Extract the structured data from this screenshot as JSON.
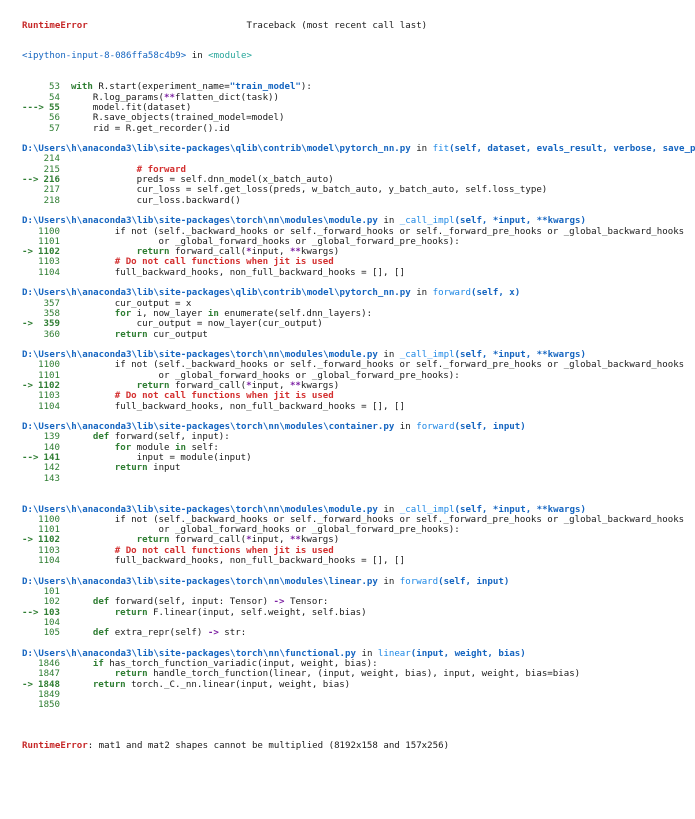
{
  "header": {
    "error_name": "RuntimeError",
    "traceback_label": "Traceback (most recent call last)",
    "input_cell": "<ipython-input-8-086ffa58c4b9>",
    "in_word": "in",
    "module_label": "<module>"
  },
  "frames": [
    {
      "lines": [
        {
          "n": "53",
          "arrow": "",
          "segs": [
            {
              "t": "with",
              "c": "kw"
            },
            {
              "t": " R.start(experiment_name=",
              "c": ""
            },
            {
              "t": "\"train_model\"",
              "c": "str"
            },
            {
              "t": "):",
              "c": ""
            }
          ]
        },
        {
          "n": "54",
          "arrow": "",
          "segs": [
            {
              "t": "    R.log_params(",
              "c": ""
            },
            {
              "t": "**",
              "c": "op"
            },
            {
              "t": "flatten_dict(task))",
              "c": ""
            }
          ]
        },
        {
          "n": "55",
          "arrow": "--->",
          "segs": [
            {
              "t": "    model.fit(dataset)",
              "c": ""
            }
          ]
        },
        {
          "n": "56",
          "arrow": "",
          "segs": [
            {
              "t": "    R.save_objects(trained_model=model)",
              "c": ""
            }
          ]
        },
        {
          "n": "57",
          "arrow": "",
          "segs": [
            {
              "t": "    rid = R.get_recorder().id",
              "c": ""
            }
          ]
        }
      ]
    },
    {
      "path": "D:\\Users\\h\\anaconda3\\lib\\site-packages\\qlib\\contrib\\model\\pytorch_nn.py",
      "func": "fit",
      "sig": "(self, dataset, evals_result, verbose, save_pa",
      "lines": [
        {
          "n": "214",
          "arrow": "",
          "segs": []
        },
        {
          "n": "215",
          "arrow": "",
          "segs": [
            {
              "t": "            # forward",
              "c": "cm"
            }
          ]
        },
        {
          "n": "216",
          "arrow": "-->",
          "segs": [
            {
              "t": "            preds = self.dnn_model(x_batch_auto)",
              "c": ""
            }
          ]
        },
        {
          "n": "217",
          "arrow": "",
          "segs": [
            {
              "t": "            cur_loss = self.get_loss(preds, w_batch_auto, y_batch_auto, self.loss_type)",
              "c": ""
            }
          ]
        },
        {
          "n": "218",
          "arrow": "",
          "segs": [
            {
              "t": "            cur_loss.backward()",
              "c": ""
            }
          ]
        }
      ]
    },
    {
      "path": "D:\\Users\\h\\anaconda3\\lib\\site-packages\\torch\\nn\\modules\\module.py",
      "func": "_call_impl",
      "sig": "(self, *input, **kwargs)",
      "lines": [
        {
          "n": "1100",
          "arrow": "",
          "segs": [
            {
              "t": "        if not (self._backward_hooks or self._forward_hooks or self._forward_pre_hooks or _global_backward_hooks",
              "c": ""
            }
          ]
        },
        {
          "n": "1101",
          "arrow": "",
          "segs": [
            {
              "t": "                or _global_forward_hooks or _global_forward_pre_hooks):",
              "c": ""
            }
          ]
        },
        {
          "n": "1102",
          "arrow": "->",
          "segs": [
            {
              "t": "            ",
              "c": ""
            },
            {
              "t": "return",
              "c": "kw"
            },
            {
              "t": " forward_call(",
              "c": ""
            },
            {
              "t": "*",
              "c": "op"
            },
            {
              "t": "input, ",
              "c": ""
            },
            {
              "t": "**",
              "c": "op"
            },
            {
              "t": "kwargs)",
              "c": ""
            }
          ]
        },
        {
          "n": "1103",
          "arrow": "",
          "segs": [
            {
              "t": "        # Do not call functions when jit is used",
              "c": "cm"
            }
          ]
        },
        {
          "n": "1104",
          "arrow": "",
          "segs": [
            {
              "t": "        full_backward_hooks, non_full_backward_hooks = [], []",
              "c": ""
            }
          ]
        }
      ]
    },
    {
      "path": "D:\\Users\\h\\anaconda3\\lib\\site-packages\\qlib\\contrib\\model\\pytorch_nn.py",
      "func": "forward",
      "sig": "(self, x)",
      "lines": [
        {
          "n": "357",
          "arrow": "",
          "segs": [
            {
              "t": "        cur_output = x",
              "c": ""
            }
          ]
        },
        {
          "n": "358",
          "arrow": "",
          "segs": [
            {
              "t": "        ",
              "c": ""
            },
            {
              "t": "for",
              "c": "kw"
            },
            {
              "t": " i, now_layer ",
              "c": ""
            },
            {
              "t": "in",
              "c": "kw"
            },
            {
              "t": " enumerate(self.dnn_layers):",
              "c": ""
            }
          ]
        },
        {
          "n": "359",
          "arrow": "->",
          "segs": [
            {
              "t": "            cur_output = now_layer(cur_output)",
              "c": ""
            }
          ]
        },
        {
          "n": "360",
          "arrow": "",
          "segs": [
            {
              "t": "        ",
              "c": ""
            },
            {
              "t": "return",
              "c": "kw"
            },
            {
              "t": " cur_output",
              "c": ""
            }
          ]
        }
      ]
    },
    {
      "path": "D:\\Users\\h\\anaconda3\\lib\\site-packages\\torch\\nn\\modules\\module.py",
      "func": "_call_impl",
      "sig": "(self, *input, **kwargs)",
      "lines": [
        {
          "n": "1100",
          "arrow": "",
          "segs": [
            {
              "t": "        if not (self._backward_hooks or self._forward_hooks or self._forward_pre_hooks or _global_backward_hooks",
              "c": ""
            }
          ]
        },
        {
          "n": "1101",
          "arrow": "",
          "segs": [
            {
              "t": "                or _global_forward_hooks or _global_forward_pre_hooks):",
              "c": ""
            }
          ]
        },
        {
          "n": "1102",
          "arrow": "->",
          "segs": [
            {
              "t": "            ",
              "c": ""
            },
            {
              "t": "return",
              "c": "kw"
            },
            {
              "t": " forward_call(",
              "c": ""
            },
            {
              "t": "*",
              "c": "op"
            },
            {
              "t": "input, ",
              "c": ""
            },
            {
              "t": "**",
              "c": "op"
            },
            {
              "t": "kwargs)",
              "c": ""
            }
          ]
        },
        {
          "n": "1103",
          "arrow": "",
          "segs": [
            {
              "t": "        # Do not call functions when jit is used",
              "c": "cm"
            }
          ]
        },
        {
          "n": "1104",
          "arrow": "",
          "segs": [
            {
              "t": "        full_backward_hooks, non_full_backward_hooks = [], []",
              "c": ""
            }
          ]
        }
      ]
    },
    {
      "path": "D:\\Users\\h\\anaconda3\\lib\\site-packages\\torch\\nn\\modules\\container.py",
      "func": "forward",
      "sig": "(self, input)",
      "trail": 1,
      "lines": [
        {
          "n": "139",
          "arrow": "",
          "segs": [
            {
              "t": "    ",
              "c": ""
            },
            {
              "t": "def",
              "c": "kw"
            },
            {
              "t": " forward(self, input):",
              "c": ""
            }
          ]
        },
        {
          "n": "140",
          "arrow": "",
          "segs": [
            {
              "t": "        ",
              "c": ""
            },
            {
              "t": "for",
              "c": "kw"
            },
            {
              "t": " module ",
              "c": ""
            },
            {
              "t": "in",
              "c": "kw"
            },
            {
              "t": " self:",
              "c": ""
            }
          ]
        },
        {
          "n": "141",
          "arrow": "-->",
          "segs": [
            {
              "t": "            input = module(input)",
              "c": ""
            }
          ]
        },
        {
          "n": "142",
          "arrow": "",
          "segs": [
            {
              "t": "        ",
              "c": ""
            },
            {
              "t": "return",
              "c": "kw"
            },
            {
              "t": " input",
              "c": ""
            }
          ]
        },
        {
          "n": "143",
          "arrow": "",
          "segs": []
        }
      ]
    },
    {
      "path": "D:\\Users\\h\\anaconda3\\lib\\site-packages\\torch\\nn\\modules\\module.py",
      "func": "_call_impl",
      "sig": "(self, *input, **kwargs)",
      "lines": [
        {
          "n": "1100",
          "arrow": "",
          "segs": [
            {
              "t": "        if not (self._backward_hooks or self._forward_hooks or self._forward_pre_hooks or _global_backward_hooks",
              "c": ""
            }
          ]
        },
        {
          "n": "1101",
          "arrow": "",
          "segs": [
            {
              "t": "                or _global_forward_hooks or _global_forward_pre_hooks):",
              "c": ""
            }
          ]
        },
        {
          "n": "1102",
          "arrow": "->",
          "segs": [
            {
              "t": "            ",
              "c": ""
            },
            {
              "t": "return",
              "c": "kw"
            },
            {
              "t": " forward_call(",
              "c": ""
            },
            {
              "t": "*",
              "c": "op"
            },
            {
              "t": "input, ",
              "c": ""
            },
            {
              "t": "**",
              "c": "op"
            },
            {
              "t": "kwargs)",
              "c": ""
            }
          ]
        },
        {
          "n": "1103",
          "arrow": "",
          "segs": [
            {
              "t": "        # Do not call functions when jit is used",
              "c": "cm"
            }
          ]
        },
        {
          "n": "1104",
          "arrow": "",
          "segs": [
            {
              "t": "        full_backward_hooks, non_full_backward_hooks = [], []",
              "c": ""
            }
          ]
        }
      ]
    },
    {
      "path": "D:\\Users\\h\\anaconda3\\lib\\site-packages\\torch\\nn\\modules\\linear.py",
      "func": "forward",
      "sig": "(self, input)",
      "lines": [
        {
          "n": "101",
          "arrow": "",
          "segs": []
        },
        {
          "n": "102",
          "arrow": "",
          "segs": [
            {
              "t": "    ",
              "c": ""
            },
            {
              "t": "def",
              "c": "kw"
            },
            {
              "t": " forward(self, input: Tensor) ",
              "c": ""
            },
            {
              "t": "->",
              "c": "op"
            },
            {
              "t": " Tensor:",
              "c": ""
            }
          ]
        },
        {
          "n": "103",
          "arrow": "-->",
          "segs": [
            {
              "t": "        ",
              "c": ""
            },
            {
              "t": "return",
              "c": "kw"
            },
            {
              "t": " F.linear(input, self.weight, self.bias)",
              "c": ""
            }
          ]
        },
        {
          "n": "104",
          "arrow": "",
          "segs": []
        },
        {
          "n": "105",
          "arrow": "",
          "segs": [
            {
              "t": "    ",
              "c": ""
            },
            {
              "t": "def",
              "c": "kw"
            },
            {
              "t": " extra_repr(self) ",
              "c": ""
            },
            {
              "t": "->",
              "c": "op"
            },
            {
              "t": " str:",
              "c": ""
            }
          ]
        }
      ]
    },
    {
      "path": "D:\\Users\\h\\anaconda3\\lib\\site-packages\\torch\\nn\\functional.py",
      "func": "linear",
      "sig": "(input, weight, bias)",
      "lines": [
        {
          "n": "1846",
          "arrow": "",
          "segs": [
            {
              "t": "    ",
              "c": ""
            },
            {
              "t": "if",
              "c": "kw"
            },
            {
              "t": " has_torch_function_variadic(input, weight, bias):",
              "c": ""
            }
          ]
        },
        {
          "n": "1847",
          "arrow": "",
          "segs": [
            {
              "t": "        ",
              "c": ""
            },
            {
              "t": "return",
              "c": "kw"
            },
            {
              "t": " handle_torch_function(linear, (input, weight, bias), input, weight, bias=bias)",
              "c": ""
            }
          ]
        },
        {
          "n": "1848",
          "arrow": "->",
          "segs": [
            {
              "t": "    ",
              "c": ""
            },
            {
              "t": "return",
              "c": "kw"
            },
            {
              "t": " torch._C._nn.linear(input, weight, bias)",
              "c": ""
            }
          ]
        },
        {
          "n": "1849",
          "arrow": "",
          "segs": []
        },
        {
          "n": "1850",
          "arrow": "",
          "segs": []
        }
      ]
    }
  ],
  "final_error": {
    "name": "RuntimeError",
    "message": ": mat1 and mat2 shapes cannot be multiplied (8192x158 and 157x256)"
  }
}
